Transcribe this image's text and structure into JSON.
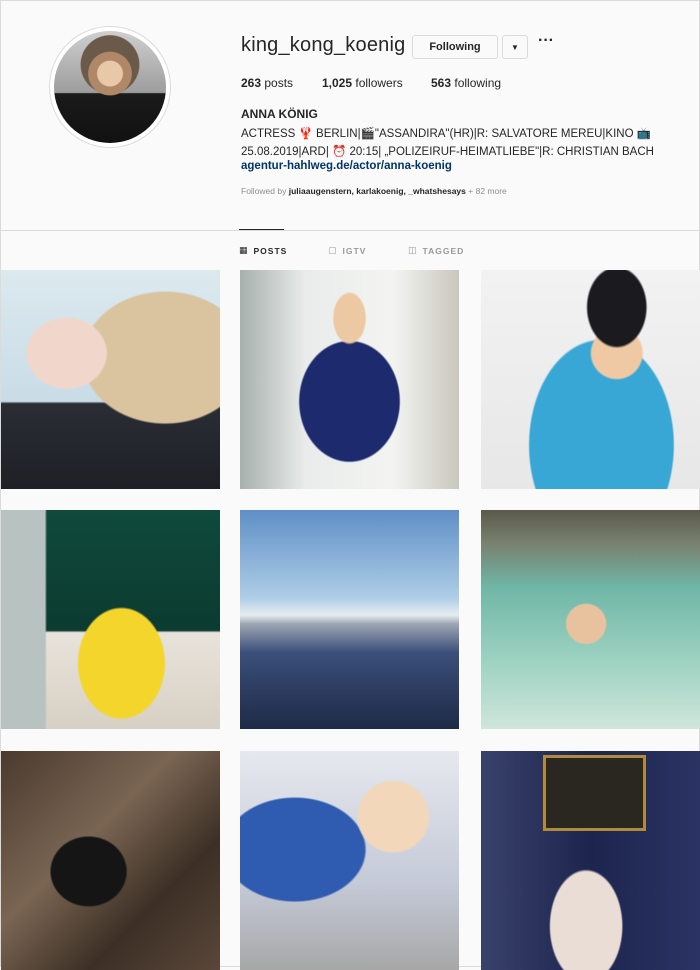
{
  "profile": {
    "username": "king_kong_koenig",
    "following_label": "Following",
    "dropdown_icon": "triangle-down",
    "more_icon": "ellipsis",
    "stats": {
      "posts_count": "263",
      "posts_label": "posts",
      "followers_count": "1,025",
      "followers_label": "followers",
      "following_count": "563",
      "following_label": "following"
    },
    "full_name": "ANNA KÖNIG",
    "bio_line1": "ACTRESS 🦞 BERLIN|🎬\"ASSANDIRA\"(HR)|R: SALVATORE MEREU|KINO 📺",
    "bio_line2": "25.08.2019|ARD| ⏰ 20:15| „POLIZEIRUF-HEIMATLIEBE\"|R: CHRISTIAN BACH",
    "bio_link": "agentur-hahlweg.de/actor/anna-koenig",
    "followed_by_prefix": "Followed by",
    "followed_by_users": "juliaaugenstern, karlakoenig, _whatshesays",
    "followed_by_more": "+ 82 more"
  },
  "tabs": [
    {
      "label": "POSTS",
      "icon": "grid-icon",
      "active": true
    },
    {
      "label": "IGTV",
      "icon": "igtv-icon",
      "active": false
    },
    {
      "label": "TAGGED",
      "icon": "tag-icon",
      "active": false
    }
  ],
  "colors": {
    "text": "#262626",
    "muted": "#8e8e8e",
    "link": "#003569",
    "border": "#dbdbdb",
    "background": "#fafafa"
  }
}
